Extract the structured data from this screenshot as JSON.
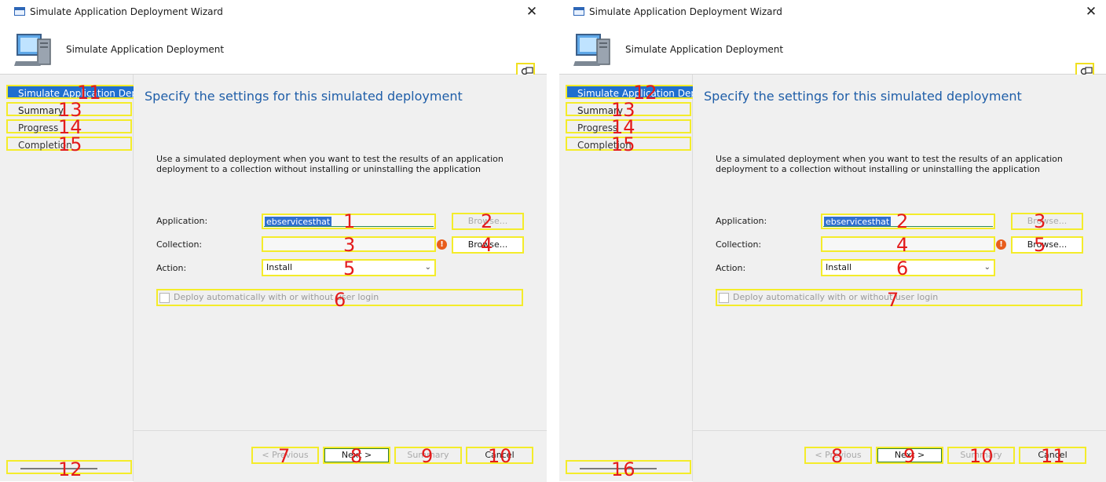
{
  "left": {
    "title": "Simulate Application Deployment Wizard",
    "close_glyph": "✕",
    "header_title": "Simulate Application Deployment",
    "nav": [
      "Simulate Application Deploy",
      "Summary",
      "Progress",
      "Completion"
    ],
    "page_title": "Specify the settings for this simulated deployment",
    "description": "Use a simulated deployment when you want to test the results of an application deployment to a collection without installing or uninstalling the application",
    "application_label": "Application:",
    "application_value": "ebservicesthat",
    "collection_label": "Collection:",
    "collection_value": "",
    "action_label": "Action:",
    "action_value": "Install",
    "browse1": "Browse...",
    "browse2": "Browse...",
    "checkbox_label": "Deploy automatically with or without user login",
    "prev": "< Previous",
    "next": "Next >",
    "summary": "Summary",
    "cancel": "Cancel",
    "markers": {
      "application": "1",
      "browse1": "2",
      "collection": "3",
      "browse2": "4",
      "action": "5",
      "checkbox": "6",
      "prev": "7",
      "next": "8",
      "summary": "9",
      "cancel": "10",
      "nav0": "11",
      "scrollbar": "12",
      "nav1": "13",
      "nav2": "14",
      "nav3": "15"
    }
  },
  "right": {
    "title": "Simulate Application Deployment Wizard",
    "close_glyph": "✕",
    "header_title": "Simulate Application Deployment",
    "nav": [
      "Simulate Application Deploy",
      "Summary",
      "Progress",
      "Completion"
    ],
    "page_title": "Specify the settings for this simulated deployment",
    "description": "Use a simulated deployment when you want to test the results of an application deployment to a collection without installing or uninstalling the application",
    "application_label": "Application:",
    "application_value": "ebservicesthat",
    "collection_label": "Collection:",
    "collection_value": "",
    "action_label": "Action:",
    "action_value": "Install",
    "browse1": "Browse...",
    "browse2": "Browse...",
    "checkbox_label": "Deploy automatically with or without user login",
    "prev": "< Previous",
    "next": "Next >",
    "summary": "Summary",
    "cancel": "Cancel",
    "markers": {
      "application": "2",
      "browse1": "3",
      "collection": "4",
      "browse2": "5",
      "action": "6",
      "checkbox": "7",
      "prev": "8",
      "next": "9",
      "summary": "10",
      "cancel": "11",
      "nav0": "12",
      "scrollbar": "16",
      "nav1": "13",
      "nav2": "14",
      "nav3": "15"
    }
  },
  "colors": {
    "accent": "#1f6fcf",
    "annotation_box": "#f4ec2a",
    "annotation_number": "#e31b1b",
    "title_blue": "#1f5ea8",
    "warning": "#e85d1c"
  },
  "icons": [
    "computer-icon",
    "help-icon",
    "warning-icon",
    "close-icon",
    "chevron-down-icon",
    "window-icon"
  ]
}
